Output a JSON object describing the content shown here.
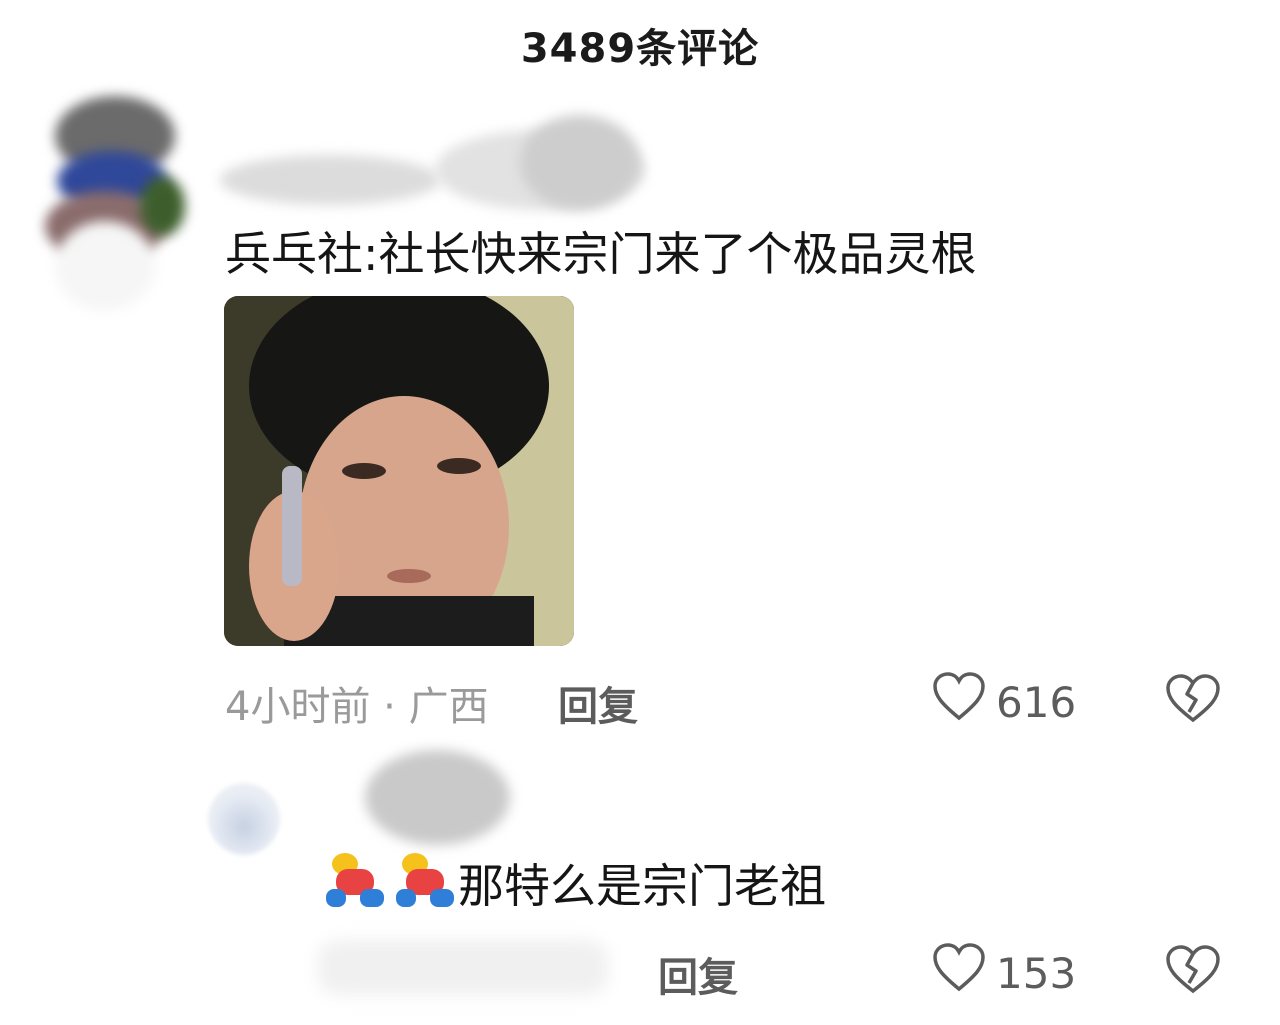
{
  "header": {
    "title": "3489条评论"
  },
  "comment": {
    "text": "兵乓社:社长快来宗门来了个极品灵根",
    "meta": "4小时前 · 广西",
    "reply_label": "回复",
    "like_count": "616"
  },
  "reply": {
    "text": "那特么是宗门老祖",
    "emoji_icon": "falling-person-icon",
    "reply_label": "回复",
    "like_count": "153"
  },
  "colors": {
    "icon_gray": "#5c5c5c",
    "meta_gray": "#9a9a9a"
  }
}
